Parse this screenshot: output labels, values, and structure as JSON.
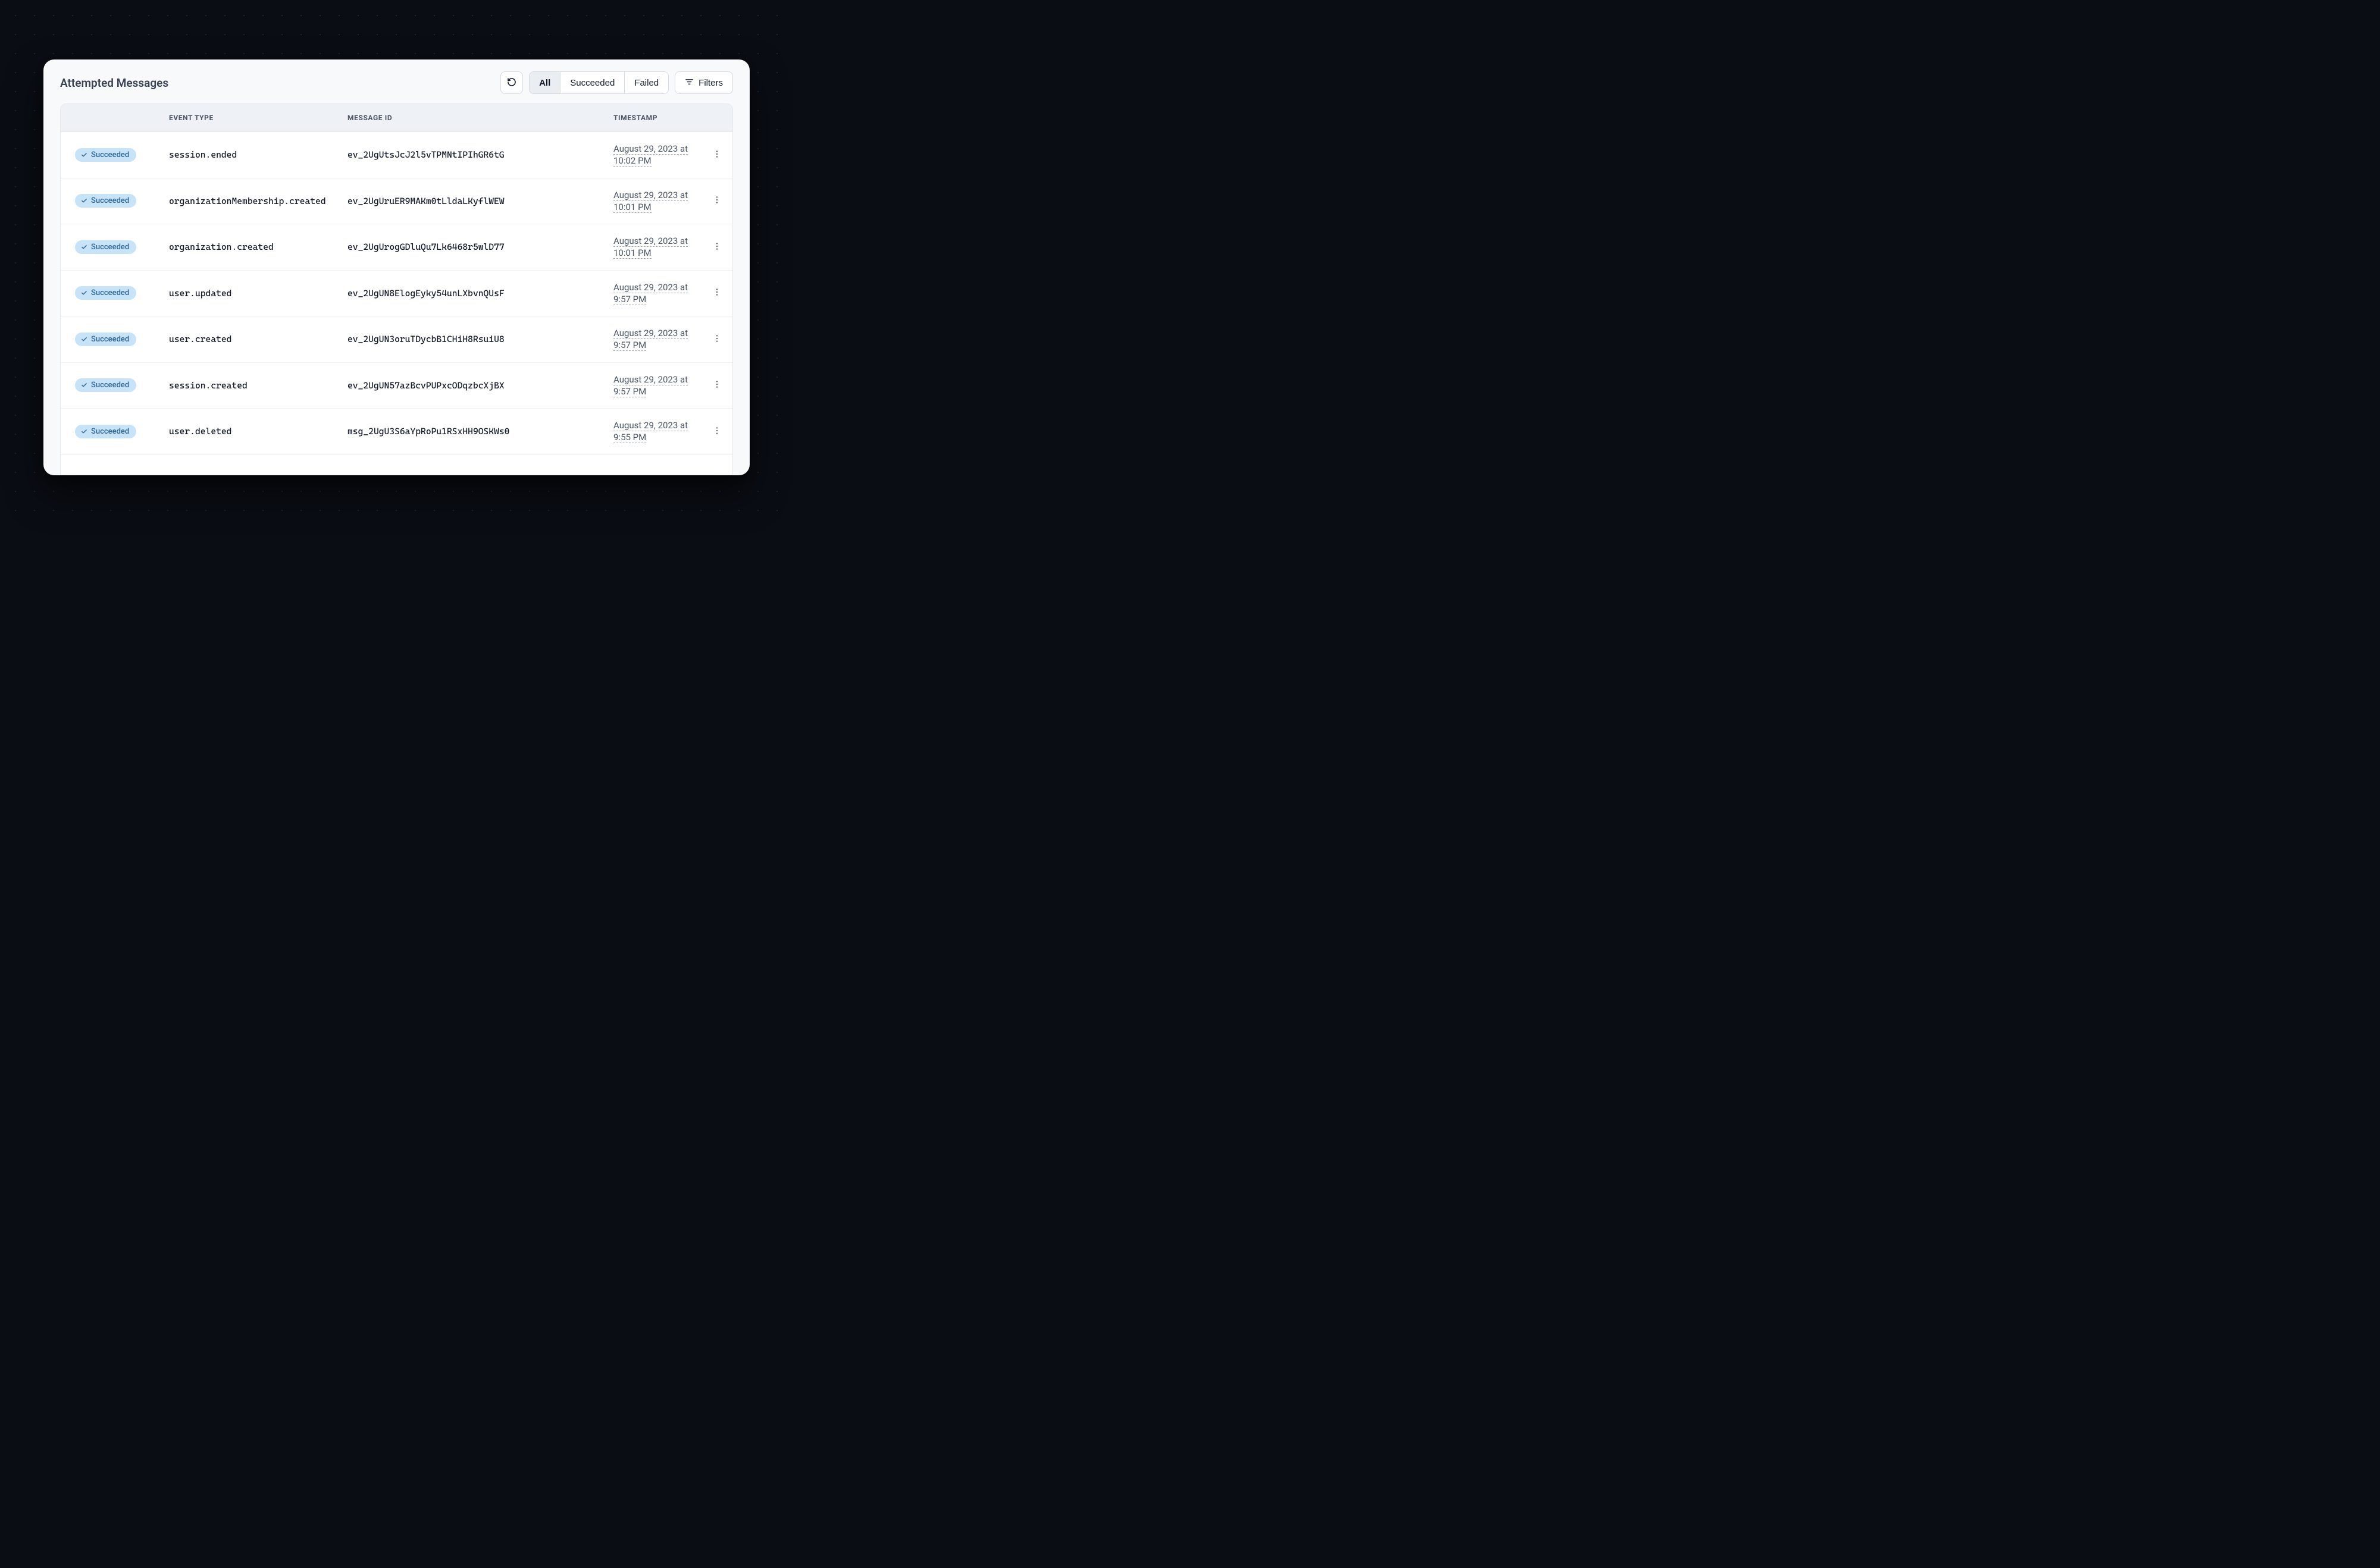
{
  "title": "Attempted Messages",
  "toolbar": {
    "tabs": {
      "all": "All",
      "succeeded": "Succeeded",
      "failed": "Failed"
    },
    "filters_label": "Filters"
  },
  "columns": {
    "status": "",
    "event_type": "EVENT TYPE",
    "message_id": "MESSAGE ID",
    "timestamp": "TIMESTAMP"
  },
  "badge_succeeded": "Succeeded",
  "rows": [
    {
      "event_type": "session.ended",
      "message_id": "ev_2UgUtsJcJ2l5vTPMNtIPIhGR6tG",
      "timestamp": "August 29, 2023 at 10:02 PM"
    },
    {
      "event_type": "organizationMembership.created",
      "message_id": "ev_2UgUruER9MAKm0tLldaLKyflWEW",
      "timestamp": "August 29, 2023 at 10:01 PM"
    },
    {
      "event_type": "organization.created",
      "message_id": "ev_2UgUrogGDluQu7Lk6468r5wlD77",
      "timestamp": "August 29, 2023 at 10:01 PM"
    },
    {
      "event_type": "user.updated",
      "message_id": "ev_2UgUN8ElogEyky54unLXbvnQUsF",
      "timestamp": "August 29, 2023 at 9:57 PM"
    },
    {
      "event_type": "user.created",
      "message_id": "ev_2UgUN3oruTDycbB1CHiH8RsuiU8",
      "timestamp": "August 29, 2023 at 9:57 PM"
    },
    {
      "event_type": "session.created",
      "message_id": "ev_2UgUN57azBcvPUPxcODqzbcXjBX",
      "timestamp": "August 29, 2023 at 9:57 PM"
    },
    {
      "event_type": "user.deleted",
      "message_id": "msg_2UgU3S6aYpRoPu1RSxHH9OSKWs0",
      "timestamp": "August 29, 2023 at 9:55 PM"
    }
  ]
}
